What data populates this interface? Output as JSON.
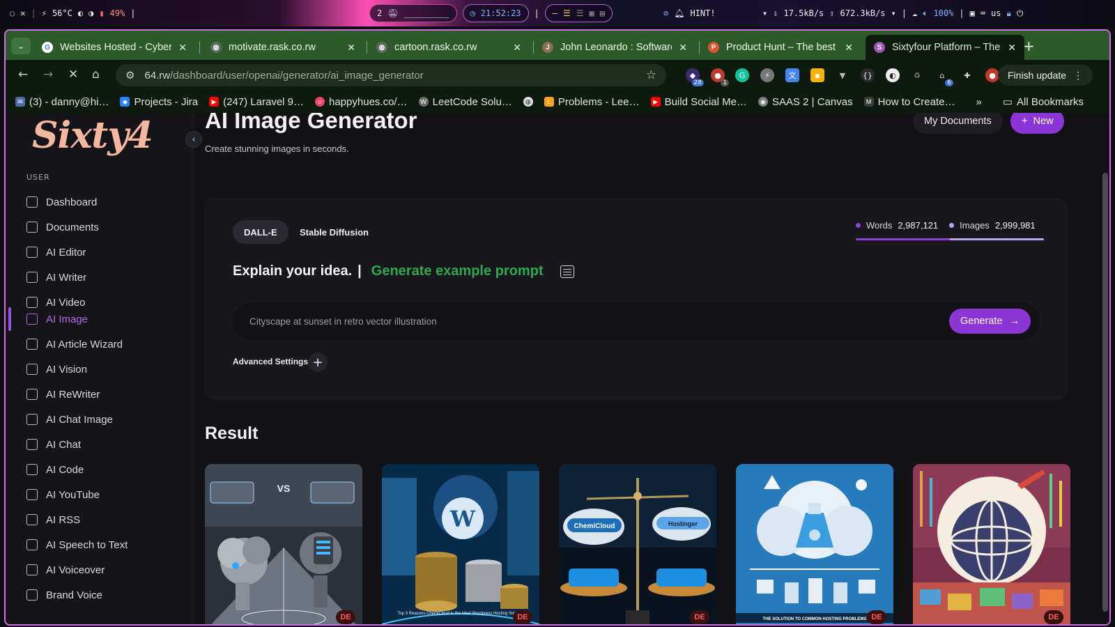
{
  "os_bar": {
    "workspace_icons": [
      "droplet-icon",
      "leaf-icon"
    ],
    "cpu_temp": "56°C",
    "battery": "49%",
    "workspace_num": "2",
    "workspace_dashes": "_________",
    "clock": "21:52:23",
    "hint_label": "HINT!",
    "net_down": "17.5kB/s",
    "net_up": "672.3kB/s",
    "volume": "100%",
    "keyboard_layout": "us"
  },
  "tabs": [
    {
      "title": "Websites Hosted - Cyber",
      "favicon_color": "#ffffff",
      "favicon_letter": "G"
    },
    {
      "title": "motivate.rask.co.rw",
      "favicon_color": "#5f6b5f",
      "favicon_letter": "◍"
    },
    {
      "title": "cartoon.rask.co.rw",
      "favicon_color": "#5f6b5f",
      "favicon_letter": "◍"
    },
    {
      "title": "John Leonardo : Software",
      "favicon_color": "#8a6d4e",
      "favicon_letter": "J"
    },
    {
      "title": "Product Hunt – The best n",
      "favicon_color": "#da552f",
      "favicon_letter": "P"
    },
    {
      "title": "Sixtyfour Platform – The U",
      "favicon_color": "#9b59b6",
      "favicon_letter": "S"
    }
  ],
  "toolbar": {
    "url_host": "64.rw",
    "url_path": "/dashboard/user/openai/generator/ai_image_generator",
    "finish_update": "Finish update",
    "ext_badges": {
      "first": "28",
      "second": "1",
      "third": "6"
    }
  },
  "bookmarks": [
    {
      "label": "(3) - danny@hi…",
      "color": "#4a6fa5"
    },
    {
      "label": "Projects - Jira",
      "color": "#2684ff"
    },
    {
      "label": "(247) Laravel 9…",
      "color": "#ff0000"
    },
    {
      "label": "happyhues.co/…",
      "color": "#ef4565"
    },
    {
      "label": "LeetCode Solu…",
      "color": "#6b6b6b"
    },
    {
      "label": "",
      "color": "#dddddd"
    },
    {
      "label": "Problems - Lee…",
      "color": "#ffa116"
    },
    {
      "label": "Build Social Me…",
      "color": "#ff0000"
    },
    {
      "label": "SAAS 2 | Canvas",
      "color": "#7d7d7d"
    },
    {
      "label": "How to Create…",
      "color": "#3a3a3a"
    }
  ],
  "bookmarks_more": "»",
  "bookmarks_all": "All Bookmarks",
  "sidebar": {
    "logo": "Sixty4",
    "section": "USER",
    "items": [
      {
        "label": "Dashboard",
        "active": false
      },
      {
        "label": "Documents",
        "active": false
      },
      {
        "label": "AI Editor",
        "active": false
      },
      {
        "label": "AI Writer",
        "active": false
      },
      {
        "label": "AI Video",
        "active": false
      },
      {
        "label": "AI Image",
        "active": true
      },
      {
        "label": "AI Article Wizard",
        "active": false
      },
      {
        "label": "AI Vision",
        "active": false
      },
      {
        "label": "AI ReWriter",
        "active": false
      },
      {
        "label": "AI Chat Image",
        "active": false
      },
      {
        "label": "AI Chat",
        "active": false
      },
      {
        "label": "AI Code",
        "active": false
      },
      {
        "label": "AI YouTube",
        "active": false
      },
      {
        "label": "AI RSS",
        "active": false
      },
      {
        "label": "AI Speech to Text",
        "active": false
      },
      {
        "label": "AI Voiceover",
        "active": false
      },
      {
        "label": "Brand Voice",
        "active": false
      }
    ]
  },
  "header": {
    "title": "AI Image Generator",
    "subtitle": "Create stunning images in seconds.",
    "my_documents": "My Documents",
    "new_label": "New"
  },
  "generator": {
    "tabs": [
      "DALL-E",
      "Stable Diffusion"
    ],
    "active_tab": "DALL-E",
    "stats": {
      "words_label": "Words",
      "words_value": "2,987,121",
      "images_label": "Images",
      "images_value": "2,999,981",
      "words_color": "#8f3ee0",
      "images_color": "#b8a3f5",
      "words_fraction": 0.5,
      "images_fraction": 0.5
    },
    "prompt_heading": "Explain your idea.",
    "prompt_separator": "|",
    "generate_example": "Generate example prompt",
    "input_placeholder": "Cityscape at sunset in retro vector illustration",
    "input_value": "",
    "generate_label": "Generate",
    "advanced_settings": "Advanced Settings"
  },
  "results": {
    "title": "Result",
    "images": [
      {
        "badge": "DE",
        "subject": "cloud-robots-vs-illustration",
        "overlay_text": "VS",
        "caption": ""
      },
      {
        "badge": "DE",
        "subject": "wordpress-coins-illustration",
        "overlay_text": "W",
        "caption": "Top 3 Reasons ChemiCloud is the Ideal Wordpress Hosting Solution"
      },
      {
        "badge": "DE",
        "subject": "chemicloud-vs-hostinger-scale",
        "overlay_text": "ChemiCloud",
        "overlay_text_2": "Hostinger",
        "caption": ""
      },
      {
        "badge": "DE",
        "subject": "cloud-chemistry-lab-illustration",
        "overlay_text": "",
        "caption": "THE SOLUTION TO COMMON HOSTING PROBLEMS"
      },
      {
        "badge": "DE",
        "subject": "globe-cloud-colorful-illustration",
        "overlay_text": "",
        "caption": ""
      }
    ]
  }
}
